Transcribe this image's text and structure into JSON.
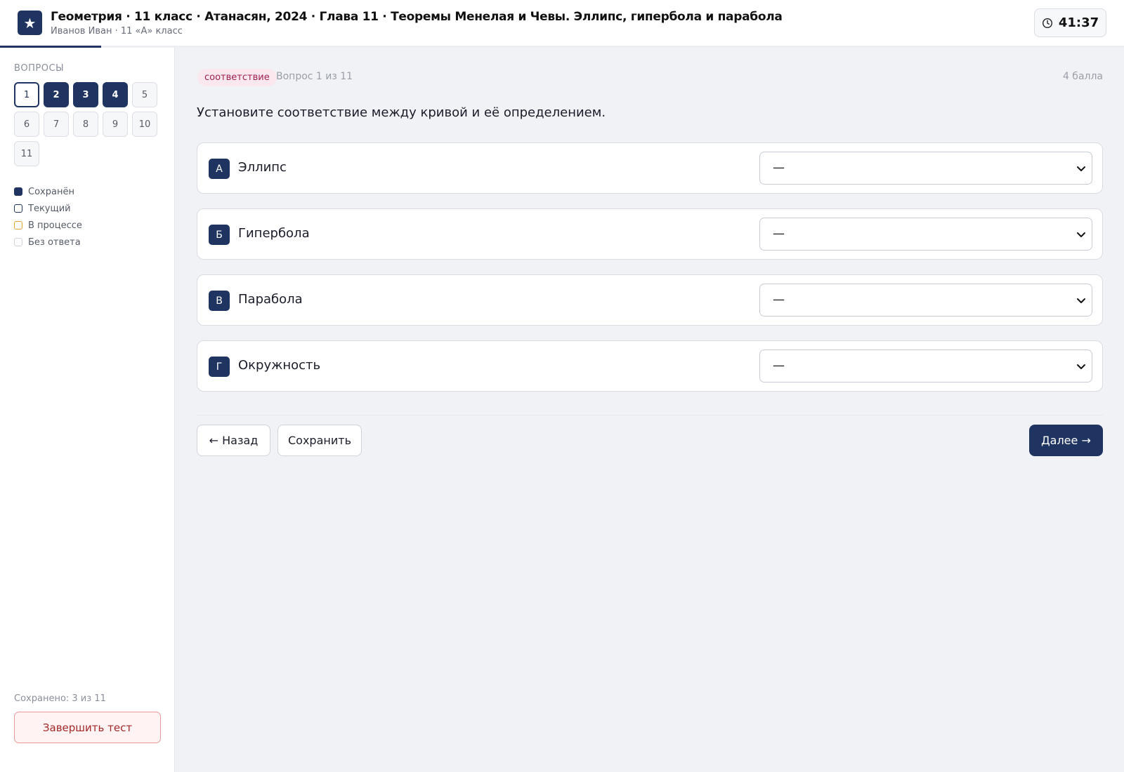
{
  "header": {
    "title": "Геометрия · 11 класс · Атанасян, 2024 · Глава 11 · Теоремы Менелая и Чевы. Эллипс, гипербола и парабола",
    "subtitle": "Иванов Иван · 11 «А» класс",
    "logo_icon": "star-icon",
    "logo_glyph": "★",
    "timer": "41:37",
    "progress_fraction": 0.09
  },
  "sidebar": {
    "label": "ВОПРОСЫ",
    "questions": [
      {
        "n": "1",
        "state": "current"
      },
      {
        "n": "2",
        "state": "saved"
      },
      {
        "n": "3",
        "state": "saved"
      },
      {
        "n": "4",
        "state": "saved"
      },
      {
        "n": "5",
        "state": "empty"
      },
      {
        "n": "6",
        "state": "empty"
      },
      {
        "n": "7",
        "state": "empty"
      },
      {
        "n": "8",
        "state": "empty"
      },
      {
        "n": "9",
        "state": "empty"
      },
      {
        "n": "10",
        "state": "empty"
      },
      {
        "n": "11",
        "state": "empty"
      }
    ],
    "legend": {
      "saved": "Сохранён",
      "current": "Текущий",
      "in_progress": "В процессе",
      "no_answer": "Без ответа"
    },
    "saved_count": "Сохранено: 3 из 11",
    "finish_label": "Завершить тест"
  },
  "main": {
    "badge": "соответствие",
    "question_number": "Вопрос 1 из 11",
    "points": "4 балла",
    "question_text": "Установите соответствие между кривой и её определением.",
    "rows": [
      {
        "letter": "А",
        "term": "Эллипс",
        "selected": "—"
      },
      {
        "letter": "Б",
        "term": "Гипербола",
        "selected": "—"
      },
      {
        "letter": "В",
        "term": "Парабола",
        "selected": "—"
      },
      {
        "letter": "Г",
        "term": "Окружность",
        "selected": "—"
      }
    ],
    "back_label": "← Назад",
    "save_label": "Сохранить",
    "next_label": "Далее →"
  },
  "colors": {
    "primary": "#1f3461",
    "badge_bg": "#fbe8ee",
    "badge_text": "#a02050",
    "danger": "#a52828",
    "in_progress": "#e3a52c"
  }
}
